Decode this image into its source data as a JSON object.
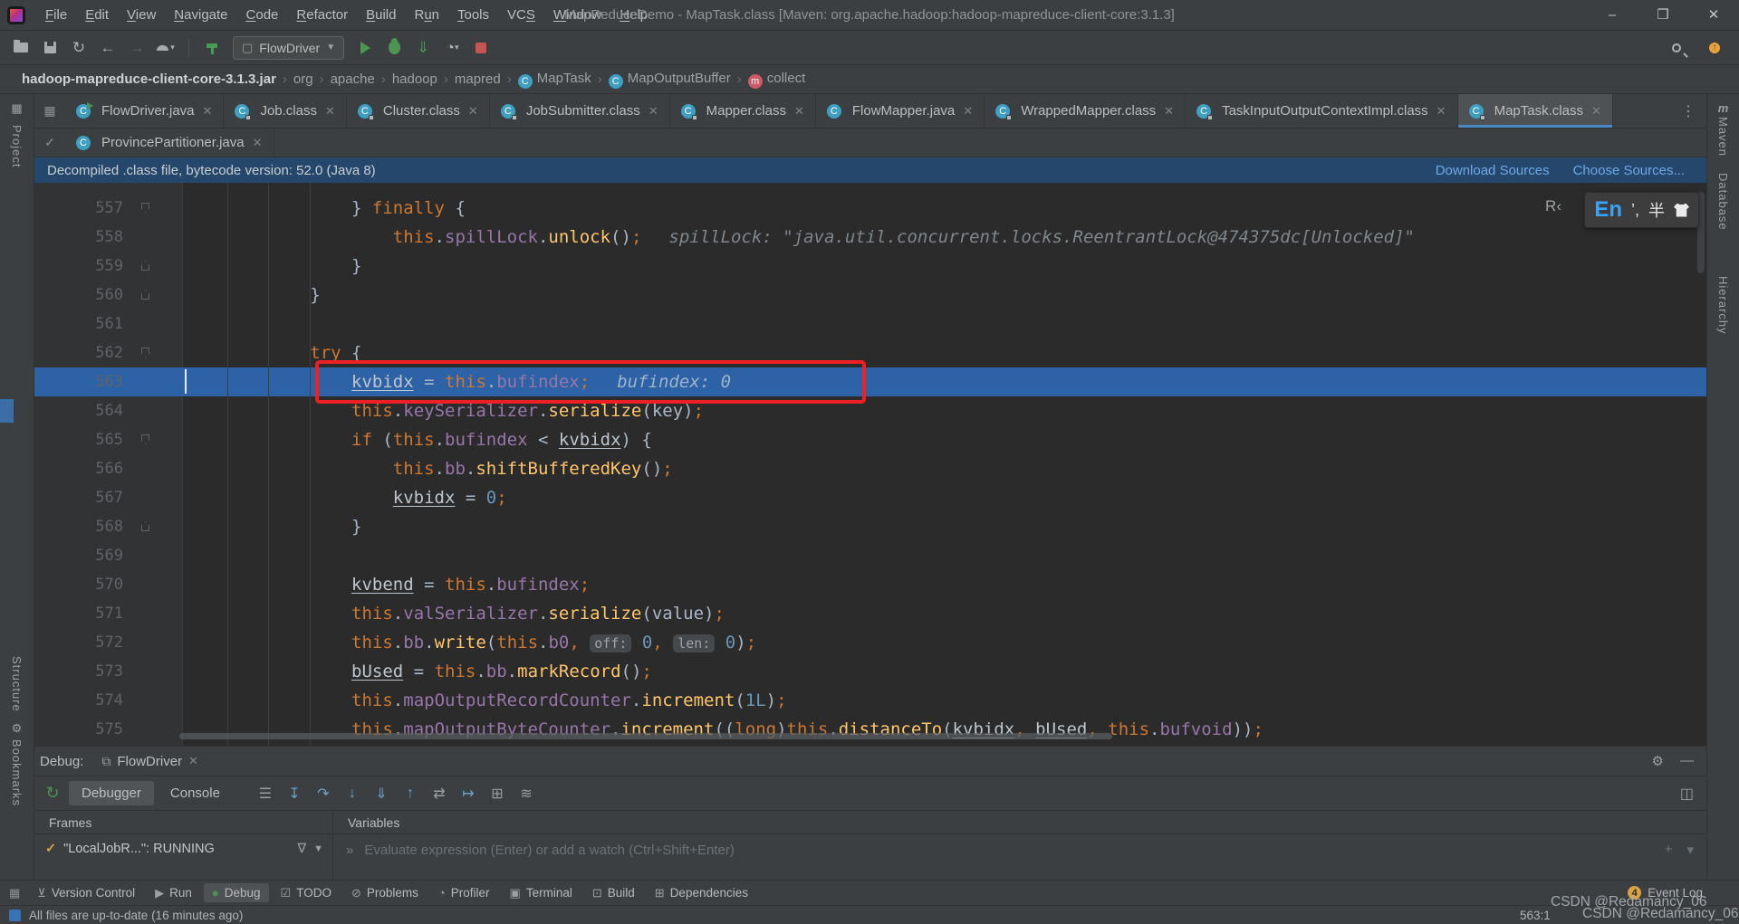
{
  "window": {
    "title": "MapReduceDemo - MapTask.class [Maven: org.apache.hadoop:hadoop-mapreduce-client-core:3.1.3]",
    "controls": {
      "minimize": "–",
      "maximize": "❐",
      "close": "✕"
    },
    "menus": [
      {
        "label": "File",
        "mnemonic": 0
      },
      {
        "label": "Edit",
        "mnemonic": 0
      },
      {
        "label": "View",
        "mnemonic": 0
      },
      {
        "label": "Navigate",
        "mnemonic": 0
      },
      {
        "label": "Code",
        "mnemonic": 0
      },
      {
        "label": "Refactor",
        "mnemonic": 0
      },
      {
        "label": "Build",
        "mnemonic": 0
      },
      {
        "label": "Run",
        "mnemonic": 1
      },
      {
        "label": "Tools",
        "mnemonic": 0
      },
      {
        "label": "VCS",
        "mnemonic": 2
      },
      {
        "label": "Window",
        "mnemonic": 0
      },
      {
        "label": "Help",
        "mnemonic": 0
      }
    ]
  },
  "toolbar": {
    "run_config": "FlowDriver"
  },
  "breadcrumbs": [
    {
      "label": "hadoop-mapreduce-client-core-3.1.3.jar",
      "icon": null,
      "bold": true
    },
    {
      "label": "org",
      "icon": null
    },
    {
      "label": "apache",
      "icon": null
    },
    {
      "label": "hadoop",
      "icon": null
    },
    {
      "label": "mapred",
      "icon": null
    },
    {
      "label": "MapTask",
      "icon": "class"
    },
    {
      "label": "MapOutputBuffer",
      "icon": "class"
    },
    {
      "label": "collect",
      "icon": "method"
    }
  ],
  "tabs_row1": [
    {
      "label": "FlowDriver.java",
      "kind": "java-run"
    },
    {
      "label": "Job.class",
      "kind": "class"
    },
    {
      "label": "Cluster.class",
      "kind": "class"
    },
    {
      "label": "JobSubmitter.class",
      "kind": "class"
    },
    {
      "label": "Mapper.class",
      "kind": "class"
    },
    {
      "label": "FlowMapper.java",
      "kind": "java"
    },
    {
      "label": "WrappedMapper.class",
      "kind": "class"
    },
    {
      "label": "TaskInputOutputContextImpl.class",
      "kind": "class"
    },
    {
      "label": "MapTask.class",
      "kind": "class",
      "active": true
    }
  ],
  "tabs_row2": [
    {
      "label": "ProvincePartitioner.java",
      "kind": "java"
    }
  ],
  "notification": {
    "text": "Decompiled .class file, bytecode version: 52.0 (Java 8)",
    "links": [
      "Download Sources",
      "Choose Sources..."
    ]
  },
  "left_stripe": {
    "labels": [
      "Project",
      "Structure",
      "Bookmarks"
    ]
  },
  "right_stripe": {
    "labels": [
      "Maven",
      "Database",
      "Hierarchy"
    ]
  },
  "ime": {
    "lang": "En",
    "punct": "’,",
    "width_mode": "半",
    "partial_widget": "R‹"
  },
  "editor": {
    "lines": [
      {
        "n": 557,
        "ind": 16,
        "fold": "down",
        "t": [
          [
            "p",
            "} "
          ],
          [
            "k",
            "finally"
          ],
          [
            "p",
            " {"
          ]
        ]
      },
      {
        "n": 558,
        "ind": 20,
        "t": [
          [
            "k",
            "this"
          ],
          [
            "p",
            "."
          ],
          [
            "f",
            "spillLock"
          ],
          [
            "p",
            "."
          ],
          [
            "m",
            "unlock"
          ],
          [
            "p",
            "()"
          ],
          [
            "k",
            ";"
          ]
        ],
        "hint": "spillLock: \"java.util.concurrent.locks.ReentrantLock@474375dc[Unlocked]\""
      },
      {
        "n": 559,
        "ind": 16,
        "fold": "up",
        "t": [
          [
            "p",
            "}"
          ]
        ]
      },
      {
        "n": 560,
        "ind": 12,
        "fold": "up",
        "t": [
          [
            "p",
            "}"
          ]
        ]
      },
      {
        "n": 561,
        "ind": 0,
        "t": []
      },
      {
        "n": 562,
        "ind": 12,
        "fold": "down",
        "t": [
          [
            "k",
            "try"
          ],
          [
            "p",
            " {"
          ]
        ]
      },
      {
        "n": 563,
        "ind": 16,
        "exec": true,
        "t": [
          [
            "l",
            "kvbidx"
          ],
          [
            "p",
            " = "
          ],
          [
            "k",
            "this"
          ],
          [
            "p",
            "."
          ],
          [
            "f",
            "bufindex"
          ],
          [
            "k",
            ";"
          ]
        ],
        "hint": "bufindex: 0"
      },
      {
        "n": 564,
        "ind": 16,
        "t": [
          [
            "k",
            "this"
          ],
          [
            "p",
            "."
          ],
          [
            "f",
            "keySerializer"
          ],
          [
            "p",
            "."
          ],
          [
            "m",
            "serialize"
          ],
          [
            "p",
            "(key)"
          ],
          [
            "k",
            ";"
          ]
        ]
      },
      {
        "n": 565,
        "ind": 16,
        "fold": "down",
        "t": [
          [
            "k",
            "if"
          ],
          [
            "p",
            " ("
          ],
          [
            "k",
            "this"
          ],
          [
            "p",
            "."
          ],
          [
            "f",
            "bufindex"
          ],
          [
            "p",
            " < "
          ],
          [
            "l",
            "kvbidx"
          ],
          [
            "p",
            ") {"
          ]
        ]
      },
      {
        "n": 566,
        "ind": 20,
        "t": [
          [
            "k",
            "this"
          ],
          [
            "p",
            "."
          ],
          [
            "f",
            "bb"
          ],
          [
            "p",
            "."
          ],
          [
            "m",
            "shiftBufferedKey"
          ],
          [
            "p",
            "()"
          ],
          [
            "k",
            ";"
          ]
        ]
      },
      {
        "n": 567,
        "ind": 20,
        "t": [
          [
            "l",
            "kvbidx"
          ],
          [
            "p",
            " = "
          ],
          [
            "n",
            "0"
          ],
          [
            "k",
            ";"
          ]
        ]
      },
      {
        "n": 568,
        "ind": 16,
        "fold": "up",
        "t": [
          [
            "p",
            "}"
          ]
        ]
      },
      {
        "n": 569,
        "ind": 0,
        "t": []
      },
      {
        "n": 570,
        "ind": 16,
        "t": [
          [
            "l",
            "kvbend"
          ],
          [
            "p",
            " = "
          ],
          [
            "k",
            "this"
          ],
          [
            "p",
            "."
          ],
          [
            "f",
            "bufindex"
          ],
          [
            "k",
            ";"
          ]
        ]
      },
      {
        "n": 571,
        "ind": 16,
        "t": [
          [
            "k",
            "this"
          ],
          [
            "p",
            "."
          ],
          [
            "f",
            "valSerializer"
          ],
          [
            "p",
            "."
          ],
          [
            "m",
            "serialize"
          ],
          [
            "p",
            "(value)"
          ],
          [
            "k",
            ";"
          ]
        ]
      },
      {
        "n": 572,
        "ind": 16,
        "t": [
          [
            "k",
            "this"
          ],
          [
            "p",
            "."
          ],
          [
            "f",
            "bb"
          ],
          [
            "p",
            "."
          ],
          [
            "m",
            "write"
          ],
          [
            "p",
            "("
          ],
          [
            "k",
            "this"
          ],
          [
            "p",
            "."
          ],
          [
            "f",
            "b0"
          ],
          [
            "k",
            ","
          ],
          [
            "p",
            " "
          ],
          [
            "ph",
            "off:"
          ],
          [
            "n",
            " 0"
          ],
          [
            "k",
            ","
          ],
          [
            "p",
            " "
          ],
          [
            "ph",
            "len:"
          ],
          [
            "n",
            " 0"
          ],
          [
            "p",
            ")"
          ],
          [
            "k",
            ";"
          ]
        ]
      },
      {
        "n": 573,
        "ind": 16,
        "t": [
          [
            "l",
            "bUsed"
          ],
          [
            "p",
            " = "
          ],
          [
            "k",
            "this"
          ],
          [
            "p",
            "."
          ],
          [
            "f",
            "bb"
          ],
          [
            "p",
            "."
          ],
          [
            "m",
            "markRecord"
          ],
          [
            "p",
            "()"
          ],
          [
            "k",
            ";"
          ]
        ]
      },
      {
        "n": 574,
        "ind": 16,
        "t": [
          [
            "k",
            "this"
          ],
          [
            "p",
            "."
          ],
          [
            "f",
            "mapOutputRecordCounter"
          ],
          [
            "p",
            "."
          ],
          [
            "m",
            "increment"
          ],
          [
            "p",
            "("
          ],
          [
            "n",
            "1L"
          ],
          [
            "p",
            ")"
          ],
          [
            "k",
            ";"
          ]
        ]
      },
      {
        "n": 575,
        "ind": 16,
        "t": [
          [
            "k",
            "this"
          ],
          [
            "p",
            "."
          ],
          [
            "f",
            "mapOutputByteCounter"
          ],
          [
            "p",
            "."
          ],
          [
            "m",
            "increment"
          ],
          [
            "p",
            "(("
          ],
          [
            "k",
            "long"
          ],
          [
            "p",
            ")"
          ],
          [
            "k",
            "this"
          ],
          [
            "p",
            "."
          ],
          [
            "m",
            "distanceTo"
          ],
          [
            "p",
            "("
          ],
          [
            "l",
            "kvbidx"
          ],
          [
            "k",
            ","
          ],
          [
            "p",
            " "
          ],
          [
            "l",
            "bUsed"
          ],
          [
            "k",
            ","
          ],
          [
            "p",
            " "
          ],
          [
            "k",
            "this"
          ],
          [
            "p",
            "."
          ],
          [
            "f",
            "bufvoid"
          ],
          [
            "p",
            "))"
          ],
          [
            "k",
            ";"
          ]
        ]
      }
    ]
  },
  "debug": {
    "panel_label": "Debug:",
    "session_tab": "FlowDriver",
    "tabs": [
      "Debugger",
      "Console"
    ],
    "toolbar_icons": [
      "rerun",
      "menu",
      "show-execution-point",
      "step-over",
      "step-into",
      "force-step-into",
      "step-out",
      "drop-frame",
      "run-to-cursor",
      "evaluate",
      "trace"
    ],
    "frames": {
      "header": "Frames",
      "thread": "\"LocalJobR...\": RUNNING"
    },
    "variables": {
      "header": "Variables",
      "placeholder": "Evaluate expression (Enter) or add a watch (Ctrl+Shift+Enter)"
    }
  },
  "bottom_bar": {
    "items": [
      {
        "label": "Version Control",
        "icon": "version-control"
      },
      {
        "label": "Run",
        "icon": "run"
      },
      {
        "label": "Debug",
        "icon": "debug",
        "active": true
      },
      {
        "label": "TODO",
        "icon": "todo"
      },
      {
        "label": "Problems",
        "icon": "problems"
      },
      {
        "label": "Profiler",
        "icon": "profiler"
      },
      {
        "label": "Terminal",
        "icon": "terminal"
      },
      {
        "label": "Build",
        "icon": "build"
      },
      {
        "label": "Dependencies",
        "icon": "dependencies"
      }
    ],
    "event_log": {
      "label": "Event Log",
      "badge": "4"
    }
  },
  "status_bar": {
    "message": "All files are up-to-date (16 minutes ago)",
    "caret_position": "563:1"
  },
  "watermark": "CSDN @Redamancy_06"
}
